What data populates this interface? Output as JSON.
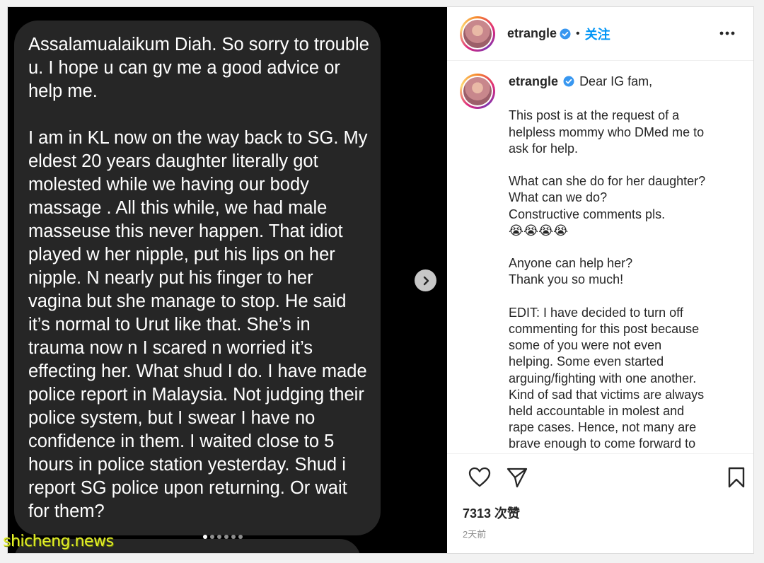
{
  "media": {
    "message_paragraphs": [
      "Assalamualaikum Diah. So sorry to trouble u. I hope u can gv me a good advice or help me.",
      "I am in KL now on the way back to SG. My eldest 20 years daughter literally got molested while we having our body massage . All this while, we had male masseuse this never happen. That idiot played w her nipple, put his lips on her nipple. N nearly put his finger to her vagina but she manage to stop. He said it’s normal to Urut like that. She’s in trauma now n I scared n worried it’s effecting her. What shud I do. I have made police report in Malaysia. Not judging their police system, but I swear I have no confidence in them. I waited close to 5 hours in police station yesterday. Shud i report SG police upon returning. Or wait for them?"
    ],
    "carousel": {
      "total": 6,
      "active_index": 0
    },
    "next_icon": "chevron-right-icon"
  },
  "watermark": "shicheng.news",
  "header": {
    "username": "etrangle",
    "separator": "•",
    "follow_label": "关注",
    "more_icon": "more-horizontal-icon",
    "verified_icon": "verified-badge-icon"
  },
  "caption": {
    "username": "etrangle",
    "lines": [
      "Dear IG fam,",
      "",
      "This post is at the request of a",
      "helpless mommy who DMed me to",
      "ask for help.",
      "",
      "What can she do for her daughter?",
      "What can we do?",
      "Constructive comments pls.",
      "😭😭😭😭",
      "",
      "Anyone can help her?",
      "Thank you so much!",
      "",
      "EDIT: I have decided to turn off",
      "commenting for this post because",
      "some of you were not even",
      "helping. Some even started",
      "arguing/fighting with one another.",
      "Kind of sad that victims are always",
      "held accountable in molest and",
      "rape cases. Hence, not many are",
      "brave enough to come forward to"
    ]
  },
  "actions": {
    "like_icon": "heart-icon",
    "share_icon": "send-icon",
    "save_icon": "bookmark-icon"
  },
  "likes_text": "7313 次赞",
  "timestamp": "2天前",
  "colors": {
    "accent": "#0095f6",
    "verified": "#3897f0",
    "bubble": "#262626",
    "watermark": "#e3ef2a"
  }
}
